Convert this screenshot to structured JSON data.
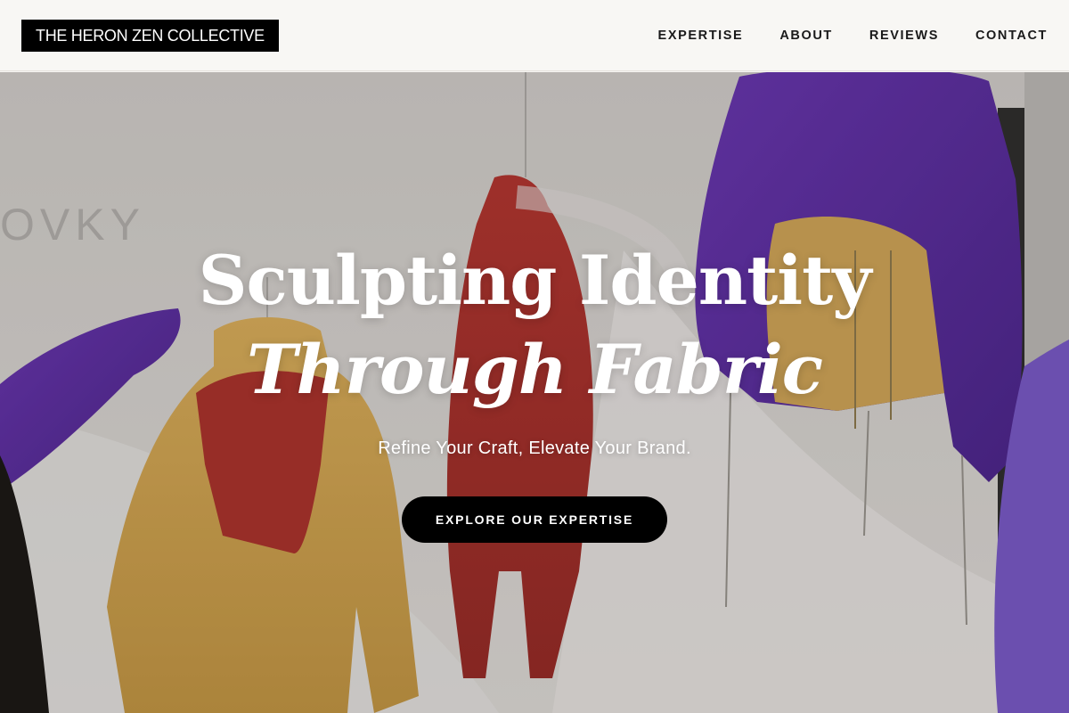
{
  "brand": {
    "name": "THE HERON ZEN COLLECTIVE"
  },
  "nav": {
    "items": [
      {
        "label": "EXPERTISE"
      },
      {
        "label": "ABOUT"
      },
      {
        "label": "REVIEWS"
      },
      {
        "label": "CONTACT"
      }
    ]
  },
  "hero": {
    "title_line1": "Sculpting Identity",
    "title_line2": "Through Fabric",
    "subtitle": "Refine Your Craft, Elevate Your Brand.",
    "cta_label": "EXPLORE OUR EXPERTISE",
    "background_image": "hanging-jackets-photo",
    "wall_text": "OVKY"
  },
  "colors": {
    "header_bg": "#f8f7f4",
    "logo_bg": "#000000",
    "cta_bg": "#000000",
    "text_light": "#ffffff"
  }
}
